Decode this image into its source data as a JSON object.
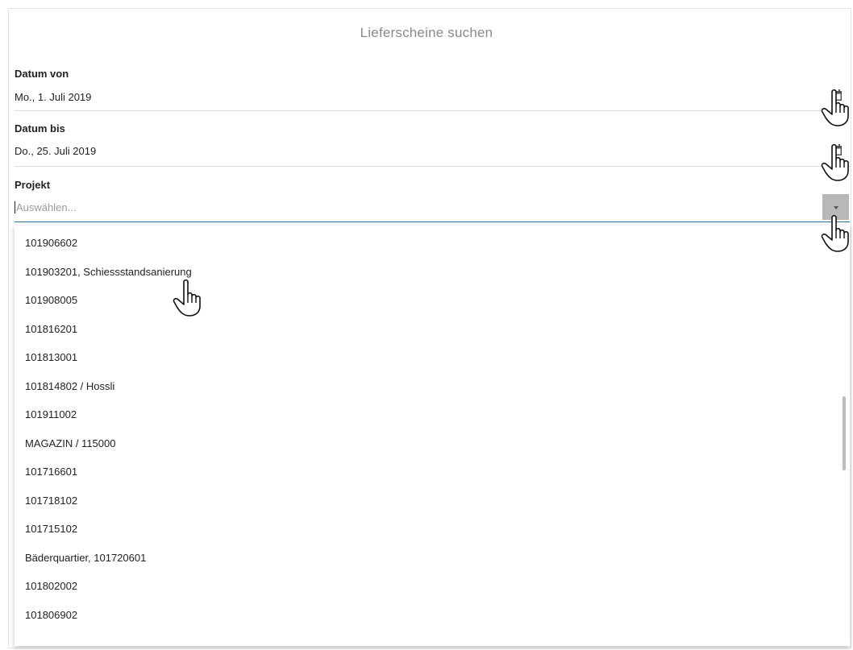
{
  "header": {
    "title": "Lieferscheine suchen"
  },
  "fields": {
    "datum_von": {
      "label": "Datum von",
      "value": "Mo., 1. Juli 2019",
      "icon": "calendar-icon"
    },
    "datum_bis": {
      "label": "Datum bis",
      "value": "Do., 25. Juli 2019",
      "icon": "calendar-icon"
    },
    "projekt": {
      "label": "Projekt",
      "value": "",
      "placeholder": "Auswählen...",
      "icon": "chevron-down-icon"
    }
  },
  "project_options": [
    "101906602",
    "101903201, Schiessstandsanierung",
    "101908005",
    "101816201",
    "101813001",
    "101814802 / Hossli",
    "101911002",
    "MAGAZIN / 115000",
    "101716601",
    "101718102",
    "101715102",
    "Bäderquartier, 101720601",
    "101802002",
    "101806902"
  ],
  "colors": {
    "title": "#8a8a8a",
    "active_underline": "#2a6fa5",
    "dropdown_button": "#b8b8b8",
    "divider": "#dcdcdc"
  }
}
